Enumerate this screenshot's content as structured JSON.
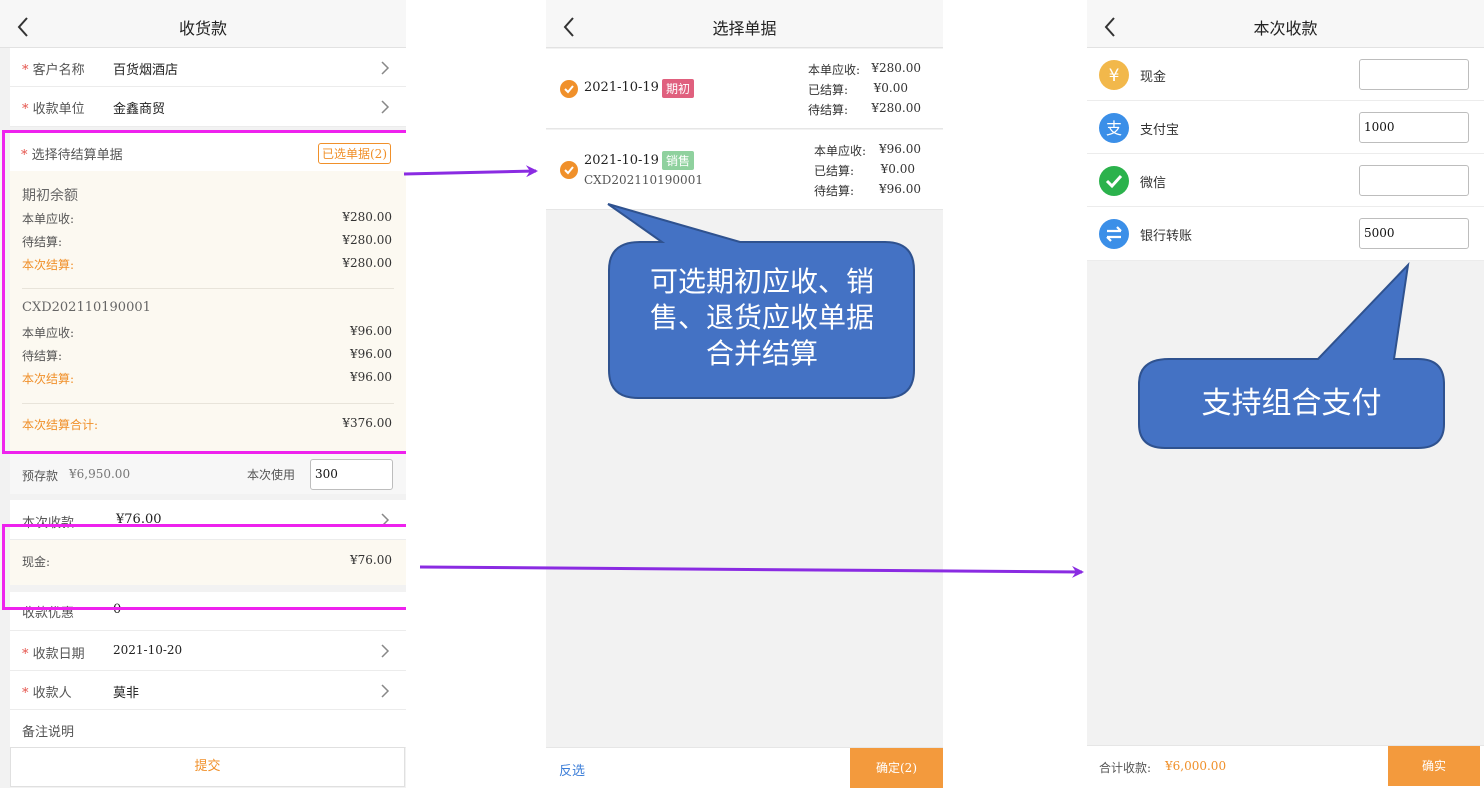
{
  "left": {
    "title": "收货款",
    "customer_label": "客户名称",
    "customer_value": "百货烟酒店",
    "unit_label": "收款单位",
    "unit_value": "金鑫商贸",
    "select_label": "选择待结算单据",
    "selected_badge": "已选单据(2)",
    "doc1": {
      "name": "期初余额",
      "due_label": "本单应收:",
      "due": "¥280.00",
      "pending_label": "待结算:",
      "pending": "¥280.00",
      "settle_label": "本次结算:",
      "settle": "¥280.00"
    },
    "doc2": {
      "name": "CXD202110190001",
      "due_label": "本单应收:",
      "due": "¥96.00",
      "pending_label": "待结算:",
      "pending": "¥96.00",
      "settle_label": "本次结算:",
      "settle": "¥96.00"
    },
    "total_label": "本次结算合计:",
    "total": "¥376.00",
    "prepaid_label": "预存款",
    "prepaid": "¥6,950.00",
    "use_label": "本次使用",
    "use_value": "300",
    "receive_label": "本次收款",
    "receive_value": "¥76.00",
    "cash_label": "现金:",
    "cash_value": "¥76.00",
    "discount_label": "收款优惠",
    "discount_value": "0",
    "date_label": "收款日期",
    "date_value": "2021-10-20",
    "payee_label": "收款人",
    "payee_value": "莫非",
    "note_label": "备注说明",
    "submit": "提交"
  },
  "middle": {
    "title": "选择单据",
    "items": [
      {
        "date": "2021-10-19",
        "tag": "期初",
        "tag_color": "#e0607e",
        "code": "",
        "due_label": "本单应收:",
        "due": "¥280.00",
        "settled_label": "已结算:",
        "settled": "¥0.00",
        "pending_label": "待结算:",
        "pending": "¥280.00"
      },
      {
        "date": "2021-10-19",
        "tag": "销售",
        "tag_color": "#8fd19e",
        "code": "CXD202110190001",
        "due_label": "本单应收:",
        "due": "¥96.00",
        "settled_label": "已结算:",
        "settled": "¥0.00",
        "pending_label": "待结算:",
        "pending": "¥96.00"
      }
    ],
    "invert": "反选",
    "confirm": "确定(2)",
    "callout": [
      "可选期初应收、销",
      "售、退货应收单据",
      "合并结算"
    ]
  },
  "right": {
    "title": "本次收款",
    "methods": [
      {
        "label": "现金",
        "value": "",
        "icon": "yen-icon",
        "color": "#f2b84b"
      },
      {
        "label": "支付宝",
        "value": "1000",
        "icon": "alipay-icon",
        "color": "#3b8fe8"
      },
      {
        "label": "微信",
        "value": "",
        "icon": "wechat-icon",
        "color": "#2bb24c"
      },
      {
        "label": "银行转账",
        "value": "5000",
        "icon": "bank-transfer-icon",
        "color": "#3b8fe8"
      }
    ],
    "total_label": "合计收款:",
    "total": "¥6,000.00",
    "confirm": "确实",
    "callout": "支持组合支付"
  },
  "colors": {
    "accent_orange": "#f0902a",
    "highlight_magenta": "#ee22ee",
    "arrow_purple": "#8a2be2",
    "callout_blue": "#4472c4"
  }
}
